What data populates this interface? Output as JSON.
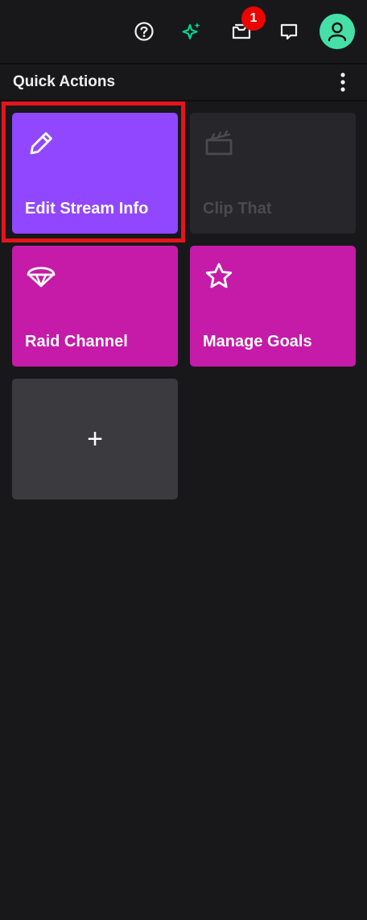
{
  "topbar": {
    "icons": [
      "help-circle-icon",
      "sparkle-icon",
      "inbox-icon",
      "chat-bubble-icon",
      "user-avatar-icon"
    ],
    "inbox_badge": "1",
    "colors": {
      "sparkle": "#00d48a",
      "avatar_bg": "#45e0a8",
      "badge": "#eb0400"
    }
  },
  "quick_actions": {
    "title": "Quick Actions",
    "menu_icon": "kebab-icon",
    "tiles": [
      {
        "label": "Edit Stream Info",
        "icon": "pencil-icon",
        "color": "#9147ff",
        "selected": true
      },
      {
        "label": "Clip That",
        "icon": "clapperboard-icon",
        "color": "#26262b",
        "disabled": true
      },
      {
        "label": "Raid Channel",
        "icon": "parachute-icon",
        "color": "#c51ba8"
      },
      {
        "label": "Manage Goals",
        "icon": "star-icon",
        "color": "#c51ba8"
      },
      {
        "label": "+",
        "icon": "plus-icon",
        "color": "#3b3b3f"
      }
    ]
  }
}
